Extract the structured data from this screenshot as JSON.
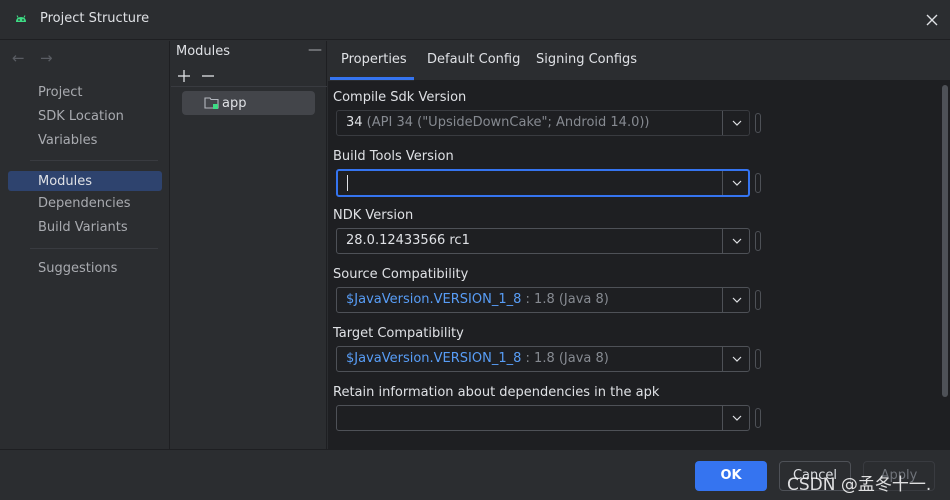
{
  "window": {
    "title": "Project Structure"
  },
  "nav": {
    "items": [
      "Project",
      "SDK Location",
      "Variables"
    ],
    "selected": "Modules",
    "items2": [
      "Dependencies",
      "Build Variants"
    ],
    "items3": [
      "Suggestions"
    ]
  },
  "modules": {
    "header": "Modules",
    "add_icon": "plus-icon",
    "remove_icon": "minus-icon",
    "list": [
      "app"
    ]
  },
  "tabs": [
    "Properties",
    "Default Config",
    "Signing Configs"
  ],
  "fields": {
    "compile_sdk": {
      "label": "Compile Sdk Version",
      "value": "34",
      "hint": " (API 34 (\"UpsideDownCake\"; Android 14.0))"
    },
    "build_tools": {
      "label": "Build Tools Version",
      "value": ""
    },
    "ndk": {
      "label": "NDK Version",
      "value": "28.0.12433566 rc1"
    },
    "source_compat": {
      "label": "Source Compatibility",
      "value": "$JavaVersion.VERSION_1_8",
      "hint": " : 1.8 (Java 8)"
    },
    "target_compat": {
      "label": "Target Compatibility",
      "value": "$JavaVersion.VERSION_1_8",
      "hint": " : 1.8 (Java 8)"
    },
    "retain_info": {
      "label": "Retain information about dependencies in the apk",
      "value": ""
    }
  },
  "buttons": {
    "ok": "OK",
    "cancel": "Cancel",
    "apply": "Apply"
  },
  "watermark": "CSDN @孟冬十一.",
  "colors": {
    "accent": "#3574f0",
    "link": "#589df6",
    "selected_nav": "#2e436e"
  }
}
